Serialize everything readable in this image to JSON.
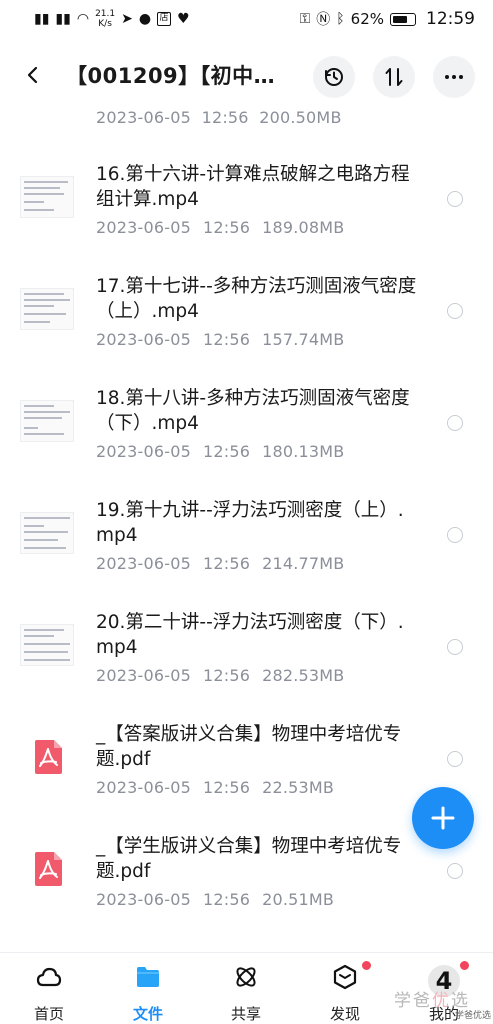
{
  "status_bar": {
    "net_speed_value": "21.1",
    "net_speed_unit": "K/s",
    "shop_badge": "店",
    "battery": "62%",
    "time": "12:59"
  },
  "header": {
    "title": "【001209】【初中…"
  },
  "partial_item": {
    "date": "2023-06-05",
    "time": "12:56",
    "size": "200.50MB"
  },
  "files": [
    {
      "name": "16.第十六讲-计算难点破解之电路方程组计算.mp4",
      "date": "2023-06-05",
      "time": "12:56",
      "size": "189.08MB",
      "type": "video"
    },
    {
      "name": "17.第十七讲--多种方法巧测固液气密度（上）.mp4",
      "date": "2023-06-05",
      "time": "12:56",
      "size": "157.74MB",
      "type": "video"
    },
    {
      "name": "18.第十八讲-多种方法巧测固液气密度（下）.mp4",
      "date": "2023-06-05",
      "time": "12:56",
      "size": "180.13MB",
      "type": "video"
    },
    {
      "name": "19.第十九讲--浮力法巧测密度（上）.mp4",
      "date": "2023-06-05",
      "time": "12:56",
      "size": "214.77MB",
      "type": "video"
    },
    {
      "name": "20.第二十讲--浮力法巧测密度（下）.mp4",
      "date": "2023-06-05",
      "time": "12:56",
      "size": "282.53MB",
      "type": "video"
    },
    {
      "name": "_【答案版讲义合集】物理中考培优专题.pdf",
      "date": "2023-06-05",
      "time": "12:56",
      "size": "22.53MB",
      "type": "pdf"
    },
    {
      "name": "_【学生版讲义合集】物理中考培优专题.pdf",
      "date": "2023-06-05",
      "time": "12:56",
      "size": "20.51MB",
      "type": "pdf"
    }
  ],
  "bottom_nav": {
    "items": [
      {
        "label": "首页",
        "icon": "cloud-icon"
      },
      {
        "label": "文件",
        "icon": "folder-icon"
      },
      {
        "label": "共享",
        "icon": "share-atom-icon"
      },
      {
        "label": "发现",
        "icon": "discover-cube-icon"
      },
      {
        "label": "我的",
        "icon": "profile-icon"
      }
    ],
    "active_index": 1
  },
  "overlay": {
    "profile_badge_number": "4",
    "watermark_main_1": "学爸",
    "watermark_main_2": "优",
    "watermark_main_3": "选",
    "watermark_small": "学爸优选"
  },
  "colors": {
    "accent": "#1d8ef5",
    "meta_text": "#8a8f99",
    "pdf_red": "#f05a6a",
    "badge_red": "#f2445a"
  }
}
